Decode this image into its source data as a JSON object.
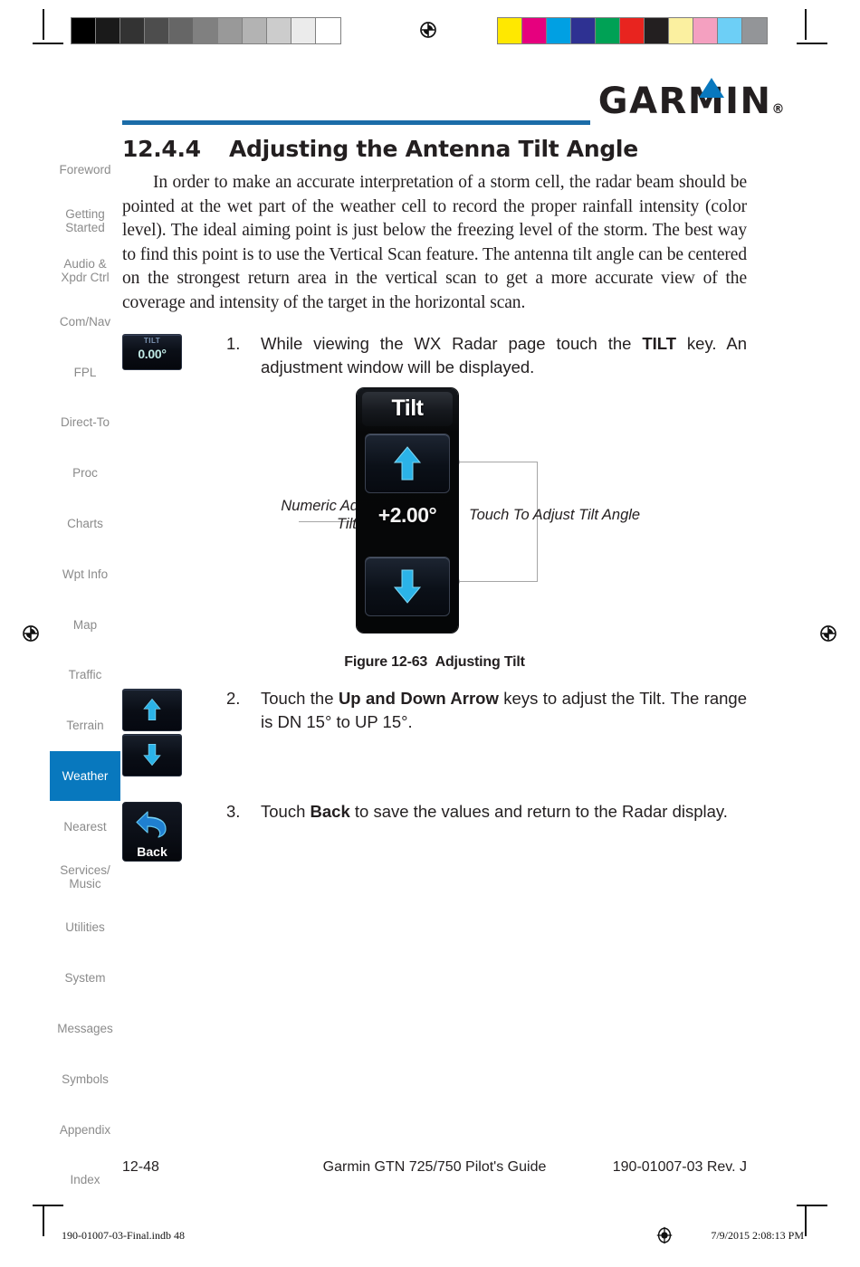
{
  "calibration": {
    "gray_swatches": [
      "#000000",
      "#1a1a1a",
      "#333333",
      "#4d4d4d",
      "#666666",
      "#808080",
      "#999999",
      "#b3b3b3",
      "#cccccc",
      "#ebebeb",
      "#ffffff"
    ],
    "color_swatches": [
      "#ffe800",
      "#e6007e",
      "#00a0e3",
      "#2e3192",
      "#00a155",
      "#e8241f",
      "#231f20",
      "#fbf0a0",
      "#f4a0c0",
      "#6dcff6",
      "#939598"
    ]
  },
  "brand": {
    "logo_text": "GARMIN",
    "registered_mark": "®",
    "accent_color": "#0878be",
    "rule_color": "#1b6ca8"
  },
  "sidebar": {
    "items": [
      {
        "label": "Foreword",
        "active": false
      },
      {
        "label": "Getting\nStarted",
        "active": false
      },
      {
        "label": "Audio &\nXpdr Ctrl",
        "active": false
      },
      {
        "label": "Com/Nav",
        "active": false
      },
      {
        "label": "FPL",
        "active": false
      },
      {
        "label": "Direct-To",
        "active": false
      },
      {
        "label": "Proc",
        "active": false
      },
      {
        "label": "Charts",
        "active": false
      },
      {
        "label": "Wpt Info",
        "active": false
      },
      {
        "label": "Map",
        "active": false
      },
      {
        "label": "Traffic",
        "active": false
      },
      {
        "label": "Terrain",
        "active": false
      },
      {
        "label": "Weather",
        "active": true
      },
      {
        "label": "Nearest",
        "active": false
      },
      {
        "label": "Services/\nMusic",
        "active": false
      },
      {
        "label": "Utilities",
        "active": false
      },
      {
        "label": "System",
        "active": false
      },
      {
        "label": "Messages",
        "active": false
      },
      {
        "label": "Symbols",
        "active": false
      },
      {
        "label": "Appendix",
        "active": false
      },
      {
        "label": "Index",
        "active": false
      }
    ]
  },
  "main": {
    "section_number": "12.4.4",
    "section_title": "Adjusting the Antenna Tilt Angle",
    "intro_paragraph": "In order to make an accurate interpretation of a storm cell, the radar beam should be pointed at the wet part of the weather cell to record the proper rainfall intensity (color level). The ideal aiming point is just below the freezing level of the storm. The best way to find this point is to use the Vertical Scan feature. The antenna tilt angle can be centered on the strongest return area in the vertical scan to get a more accurate view of the coverage and intensity of the target in the horizontal scan.",
    "steps": [
      {
        "number": "1.",
        "text_before": "While viewing the WX Radar page touch the ",
        "text_bold": "TILT",
        "text_after": " key. An adjustment window will be displayed.",
        "icon": "tilt-key-icon"
      },
      {
        "number": "2.",
        "text_before": "Touch the ",
        "text_bold": "Up and Down Arrow",
        "text_after": " keys to adjust the Tilt. The range is DN 15° to UP 15°.",
        "icon": "up-down-arrow-keys-icon"
      },
      {
        "number": "3.",
        "text_before": "Touch ",
        "text_bold": "Back",
        "text_after": " to save the values and return to the Radar display.",
        "icon": "back-key-icon"
      }
    ]
  },
  "tilt_key_icon": {
    "label": "TILT",
    "value": "0.00°"
  },
  "back_key_icon": {
    "label": "Back"
  },
  "figure": {
    "caption_number": "Figure 12-63",
    "caption_title": "Adjusting Tilt",
    "panel_title": "Tilt",
    "tilt_value": "+2.00°",
    "callout_left": "Numeric Adjusted\nTilt Angle",
    "callout_right": "Touch To Adjust Tilt Angle",
    "up_arrow_icon": "arrow-up-icon",
    "down_arrow_icon": "arrow-down-icon",
    "arrow_color": "#2bb3e8"
  },
  "footer": {
    "page_number": "12-48",
    "document_title": "Garmin GTN 725/750 Pilot's Guide",
    "part_number": "190-01007-03  Rev. J"
  },
  "print_footer": {
    "file_name": "190-01007-03-Final.indb   48",
    "timestamp": "7/9/2015   2:08:13 PM"
  }
}
